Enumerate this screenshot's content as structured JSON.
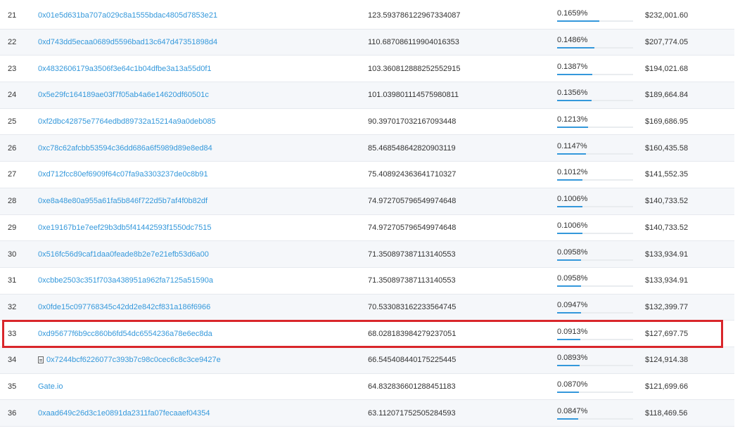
{
  "holders": [
    {
      "rank": "21",
      "address": "0x01e5d631ba707a029c8a1555bdac4805d7853e21",
      "quantity": "123.593786122967334087",
      "percentage": "0.1659%",
      "pct_value": 0.1659,
      "value": "$232,001.60",
      "is_contract": false
    },
    {
      "rank": "22",
      "address": "0xd743dd5ecaa0689d5596bad13c647d47351898d4",
      "quantity": "110.687086119904016353",
      "percentage": "0.1486%",
      "pct_value": 0.1486,
      "value": "$207,774.05",
      "is_contract": false
    },
    {
      "rank": "23",
      "address": "0x4832606179a3506f3e64c1b04dfbe3a13a55d0f1",
      "quantity": "103.360812888252552915",
      "percentage": "0.1387%",
      "pct_value": 0.1387,
      "value": "$194,021.68",
      "is_contract": false
    },
    {
      "rank": "24",
      "address": "0x5e29fc164189ae03f7f05ab4a6e14620df60501c",
      "quantity": "101.039801114575980811",
      "percentage": "0.1356%",
      "pct_value": 0.1356,
      "value": "$189,664.84",
      "is_contract": false
    },
    {
      "rank": "25",
      "address": "0xf2dbc42875e7764edbd89732a15214a9a0deb085",
      "quantity": "90.397017032167093448",
      "percentage": "0.1213%",
      "pct_value": 0.1213,
      "value": "$169,686.95",
      "is_contract": false
    },
    {
      "rank": "26",
      "address": "0xc78c62afcbb53594c36dd686a6f5989d89e8ed84",
      "quantity": "85.468548642820903119",
      "percentage": "0.1147%",
      "pct_value": 0.1147,
      "value": "$160,435.58",
      "is_contract": false
    },
    {
      "rank": "27",
      "address": "0xd712fcc80ef6909f64c07fa9a3303237de0c8b91",
      "quantity": "75.408924363641710327",
      "percentage": "0.1012%",
      "pct_value": 0.1012,
      "value": "$141,552.35",
      "is_contract": false
    },
    {
      "rank": "28",
      "address": "0xe8a48e80a955a61fa5b846f722d5b7af4f0b82df",
      "quantity": "74.972705796549974648",
      "percentage": "0.1006%",
      "pct_value": 0.1006,
      "value": "$140,733.52",
      "is_contract": false
    },
    {
      "rank": "29",
      "address": "0xe19167b1e7eef29b3db5f41442593f1550dc7515",
      "quantity": "74.972705796549974648",
      "percentage": "0.1006%",
      "pct_value": 0.1006,
      "value": "$140,733.52",
      "is_contract": false
    },
    {
      "rank": "30",
      "address": "0x516fc56d9caf1daa0feade8b2e7e21efb53d6a00",
      "quantity": "71.350897387113140553",
      "percentage": "0.0958%",
      "pct_value": 0.0958,
      "value": "$133,934.91",
      "is_contract": false
    },
    {
      "rank": "31",
      "address": "0xcbbe2503c351f703a438951a962fa7125a51590a",
      "quantity": "71.350897387113140553",
      "percentage": "0.0958%",
      "pct_value": 0.0958,
      "value": "$133,934.91",
      "is_contract": false
    },
    {
      "rank": "32",
      "address": "0x0fde15c097768345c42dd2e842cf831a186f6966",
      "quantity": "70.533083162233564745",
      "percentage": "0.0947%",
      "pct_value": 0.0947,
      "value": "$132,399.77",
      "is_contract": false
    },
    {
      "rank": "33",
      "address": "0xd95677f6b9cc860b6fd54dc6554236a78e6ec8da",
      "quantity": "68.028183984279237051",
      "percentage": "0.0913%",
      "pct_value": 0.0913,
      "value": "$127,697.75",
      "is_contract": false
    },
    {
      "rank": "34",
      "address": "0x7244bcf6226077c393b7c98c0cec6c8c3ce9427e",
      "quantity": "66.545408440175225445",
      "percentage": "0.0893%",
      "pct_value": 0.0893,
      "value": "$124,914.38",
      "is_contract": true
    },
    {
      "rank": "35",
      "address": "Gate.io",
      "quantity": "64.832836601288451183",
      "percentage": "0.0870%",
      "pct_value": 0.087,
      "value": "$121,699.66",
      "is_contract": false
    },
    {
      "rank": "36",
      "address": "0xaad649c26d3c1e0891da2311fa07fecaaef04354",
      "quantity": "63.112071752505284593",
      "percentage": "0.0847%",
      "pct_value": 0.0847,
      "value": "$118,469.56",
      "is_contract": false
    }
  ],
  "highlighted_rank": "33",
  "colors": {
    "link": "#3498db",
    "highlight_border": "#d9262b",
    "bar_fill": "#3498db",
    "bar_track": "#e9ecef"
  },
  "icons": {
    "contract": "document-icon"
  }
}
